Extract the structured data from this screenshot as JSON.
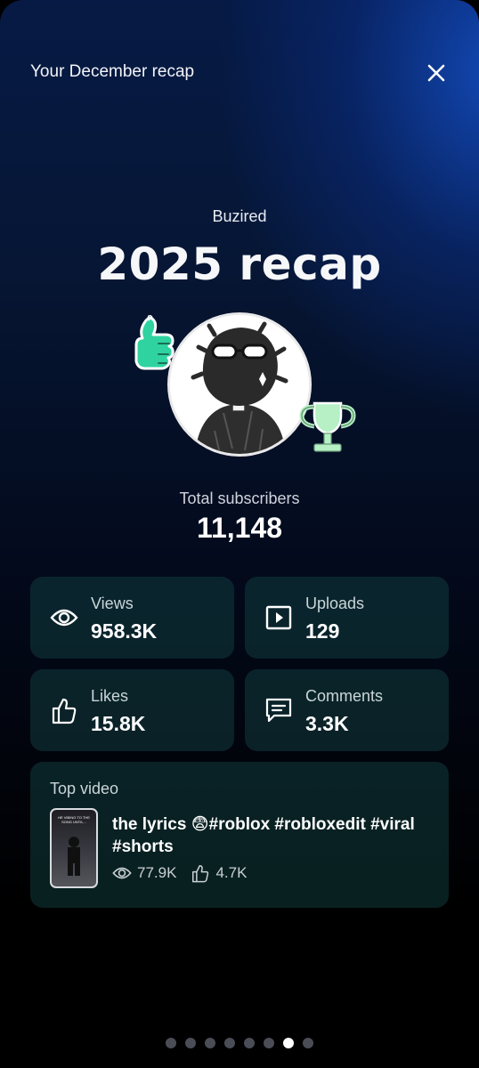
{
  "header": {
    "title": "Your December recap",
    "close_icon": "close-icon"
  },
  "channel": {
    "name": "Buzired"
  },
  "recap": {
    "title": "2025 recap"
  },
  "subscribers": {
    "label": "Total subscribers",
    "value": "11,148"
  },
  "stats": [
    {
      "label": "Views",
      "value": "958.3K",
      "icon": "eye-icon"
    },
    {
      "label": "Uploads",
      "value": "129",
      "icon": "play-box-icon"
    },
    {
      "label": "Likes",
      "value": "15.8K",
      "icon": "thumbs-up-icon"
    },
    {
      "label": "Comments",
      "value": "3.3K",
      "icon": "comment-icon"
    }
  ],
  "top_video": {
    "label": "Top video",
    "title": "the lyrics 😨#roblox #robloxedit #viral #shorts",
    "views": "77.9K",
    "likes": "4.7K",
    "thumb_caption": "HE VIBING TO THE SONG UNTIL..."
  },
  "pager": {
    "count": 8,
    "active_index": 6
  },
  "colors": {
    "card": "#14484a",
    "accent_sticker": "#2fd3a0"
  }
}
